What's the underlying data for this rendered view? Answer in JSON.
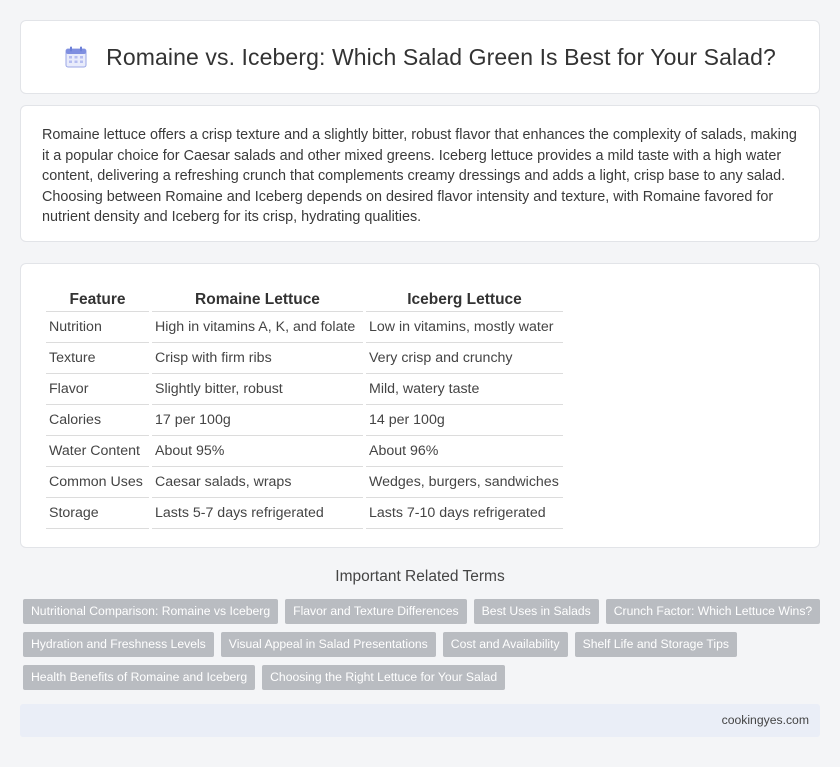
{
  "header": {
    "title": "Romaine vs. Iceberg: Which Salad Green Is Best for Your Salad?",
    "icon": "calendar-icon"
  },
  "intro": {
    "text": "Romaine lettuce offers a crisp texture and a slightly bitter, robust flavor that enhances the complexity of salads, making it a popular choice for Caesar salads and other mixed greens. Iceberg lettuce provides a mild taste with a high water content, delivering a refreshing crunch that complements creamy dressings and adds a light, crisp base to any salad. Choosing between Romaine and Iceberg depends on desired flavor intensity and texture, with Romaine favored for nutrient density and Iceberg for its crisp, hydrating qualities."
  },
  "table": {
    "headers": [
      "Feature",
      "Romaine Lettuce",
      "Iceberg Lettuce"
    ],
    "rows": [
      [
        "Nutrition",
        "High in vitamins A, K, and folate",
        "Low in vitamins, mostly water"
      ],
      [
        "Texture",
        "Crisp with firm ribs",
        "Very crisp and crunchy"
      ],
      [
        "Flavor",
        "Slightly bitter, robust",
        "Mild, watery taste"
      ],
      [
        "Calories",
        "17 per 100g",
        "14 per 100g"
      ],
      [
        "Water Content",
        "About 95%",
        "About 96%"
      ],
      [
        "Common Uses",
        "Caesar salads, wraps",
        "Wedges, burgers, sandwiches"
      ],
      [
        "Storage",
        "Lasts 5-7 days refrigerated",
        "Lasts 7-10 days refrigerated"
      ]
    ]
  },
  "terms": {
    "title": "Important Related Terms",
    "items": [
      "Nutritional Comparison: Romaine vs Iceberg",
      "Flavor and Texture Differences",
      "Best Uses in Salads",
      "Crunch Factor: Which Lettuce Wins?",
      "Hydration and Freshness Levels",
      "Visual Appeal in Salad Presentations",
      "Cost and Availability",
      "Shelf Life and Storage Tips",
      "Health Benefits of Romaine and Iceberg",
      "Choosing the Right Lettuce for Your Salad"
    ]
  },
  "footer": {
    "site": "cookingyes.com"
  },
  "colors": {
    "chip_bg": "#b9bcc1",
    "footer_bg": "#eaeef7",
    "icon_accent": "#6b7fd8"
  }
}
